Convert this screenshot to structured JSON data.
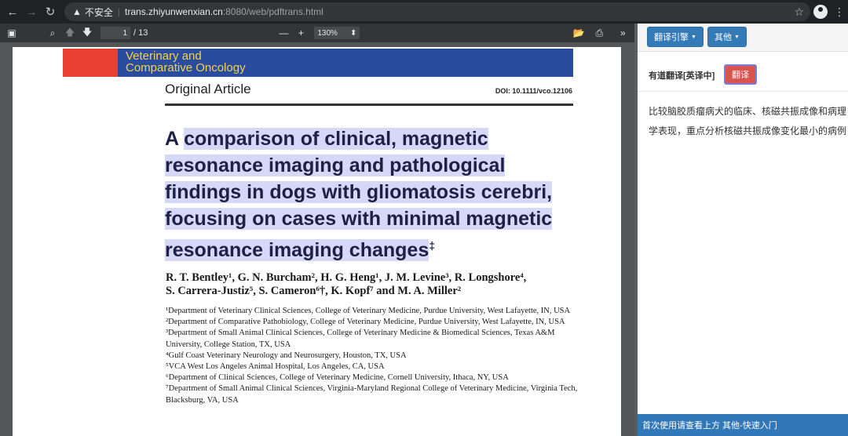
{
  "browser": {
    "back_icon": "←",
    "forward_icon": "→",
    "reload_icon": "↻",
    "warning_icon": "▲",
    "insecure_label": "不安全",
    "separator": "|",
    "host": "trans.zhiyunwenxian.cn",
    "path": ":8080/web/pdftrans.html",
    "star_icon": "☆",
    "menu_icon": "⋮"
  },
  "pdf_toolbar": {
    "sidebar_icon": "▣",
    "search_icon": "⌕",
    "prev_icon": "🡅",
    "next_icon": "🡇",
    "page_value": "1",
    "page_total": "/ 13",
    "zoom_out": "—",
    "zoom_in": "+",
    "zoom_value": "130%",
    "zoom_caret": "⬍",
    "open_icon": "📂",
    "print_icon": "⎙",
    "more_icon": "»"
  },
  "document": {
    "journal_line1": "Veterinary and",
    "journal_line2": "Comparative Oncology",
    "article_type": "Original Article",
    "doi": "DOI: 10.1111/vco.12106",
    "title_first": "A ",
    "title_highlighted": "comparison of clinical, magnetic resonance imaging and pathological findings in dogs with gliomatosis cerebri, focusing on cases with minimal magnetic resonance imaging changes",
    "title_mark": "‡",
    "authors_line1": "R. T. Bentley¹, G. N. Burcham², H. G. Heng¹, J. M. Levine³, R. Longshore⁴,",
    "authors_line2": "S. Carrera-Justiz⁵, S. Cameron⁶†, K. Kopf⁷ and M. A. Miller²",
    "affiliations": [
      "¹Department of Veterinary Clinical Sciences, College of Veterinary Medicine, Purdue University, West Lafayette, IN, USA",
      "²Department of Comparative Pathobiology, College of Veterinary Medicine, Purdue University, West Lafayette, IN, USA",
      "³Department of Small Animal Clinical Sciences, College of Veterinary Medicine & Biomedical Sciences, Texas A&M University, College Station, TX, USA",
      "⁴Gulf Coast Veterinary Neurology and Neurosurgery, Houston, TX, USA",
      "⁵VCA West Los Angeles Animal Hospital, Los Angeles, CA, USA",
      "⁶Department of Clinical Sciences, College of Veterinary Medicine, Cornell University, Ithaca, NY, USA",
      "⁷Department of Small Animal Clinical Sciences, Virginia-Maryland Regional College of Veterinary Medicine, Virginia Tech, Blacksburg, VA, USA"
    ]
  },
  "panel": {
    "engine_button": "翻译引擎",
    "other_button": "其他",
    "caret": "▼",
    "engine_label": "有道翻译[英译中]",
    "translate_button": "翻译",
    "result": "比较脑胶质瘤病犬的临床、核磁共振成像和病理学表现，重点分析核磁共振成像变化最小的病例",
    "footer": "首次使用请查看上方 其他-快速入门"
  }
}
